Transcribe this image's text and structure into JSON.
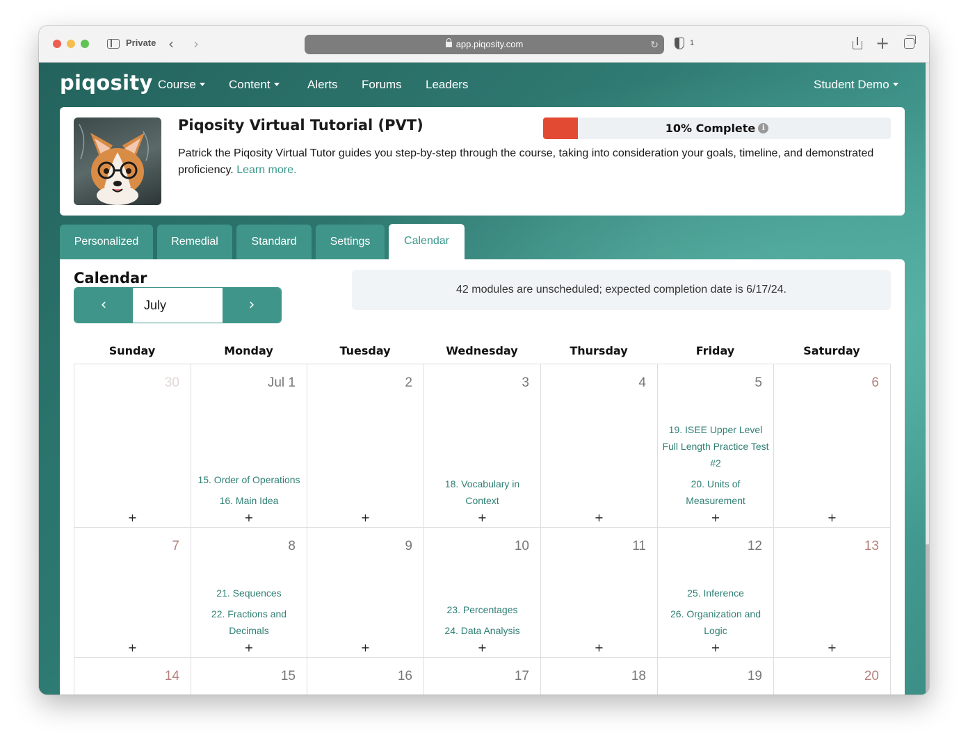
{
  "browser": {
    "private_label": "Private",
    "url": "app.piqosity.com",
    "shield_count": "1"
  },
  "nav": {
    "logo": "piqosity",
    "items": [
      {
        "label": "Course",
        "dropdown": true
      },
      {
        "label": "Content",
        "dropdown": true
      },
      {
        "label": "Alerts",
        "dropdown": false
      },
      {
        "label": "Forums",
        "dropdown": false
      },
      {
        "label": "Leaders",
        "dropdown": false
      }
    ],
    "user": "Student Demo"
  },
  "course": {
    "title": "Piqosity Virtual Tutorial (PVT)",
    "progress_label": "10% Complete",
    "progress_fraction": 0.1,
    "progress_color": "#e34a34",
    "info_icon": "i",
    "description": "Patrick the Piqosity Virtual Tutor guides you step-by-step through the course, taking into consideration your goals, timeline, and demonstrated proficiency. ",
    "learn_more": "Learn more."
  },
  "tabs": [
    {
      "label": "Personalized",
      "active": false
    },
    {
      "label": "Remedial",
      "active": false
    },
    {
      "label": "Standard",
      "active": false
    },
    {
      "label": "Settings",
      "active": false
    },
    {
      "label": "Calendar",
      "active": true
    }
  ],
  "calendar": {
    "heading": "Calendar",
    "month": "July",
    "prev_icon": "‹",
    "next_icon": "›",
    "note": "42 modules are unscheduled; expected completion date is 6/17/24.",
    "add_label": "+",
    "days": [
      "Sunday",
      "Monday",
      "Tuesday",
      "Wednesday",
      "Thursday",
      "Friday",
      "Saturday"
    ],
    "weeks": [
      [
        {
          "date": "30",
          "faded": true,
          "events": []
        },
        {
          "date": "Jul 1",
          "events": [
            "15. Order of Operations",
            "16. Main Idea"
          ]
        },
        {
          "date": "2",
          "events": []
        },
        {
          "date": "3",
          "events": [
            "18. Vocabulary in Context"
          ]
        },
        {
          "date": "4",
          "events": []
        },
        {
          "date": "5",
          "events": [
            "19. ISEE Upper Level Full Length Practice Test #2",
            "20. Units of Measurement"
          ]
        },
        {
          "date": "6",
          "events": []
        }
      ],
      [
        {
          "date": "7",
          "events": []
        },
        {
          "date": "8",
          "events": [
            "21. Sequences",
            "22. Fractions and Decimals"
          ]
        },
        {
          "date": "9",
          "events": []
        },
        {
          "date": "10",
          "events": [
            "23. Percentages",
            "24. Data Analysis"
          ]
        },
        {
          "date": "11",
          "events": []
        },
        {
          "date": "12",
          "events": [
            "25. Inference",
            "26. Organization and Logic"
          ]
        },
        {
          "date": "13",
          "events": []
        }
      ],
      [
        {
          "date": "14",
          "events": []
        },
        {
          "date": "15",
          "events": []
        },
        {
          "date": "16",
          "events": []
        },
        {
          "date": "17",
          "events": []
        },
        {
          "date": "18",
          "events": []
        },
        {
          "date": "19",
          "events": []
        },
        {
          "date": "20",
          "events": []
        }
      ]
    ]
  }
}
